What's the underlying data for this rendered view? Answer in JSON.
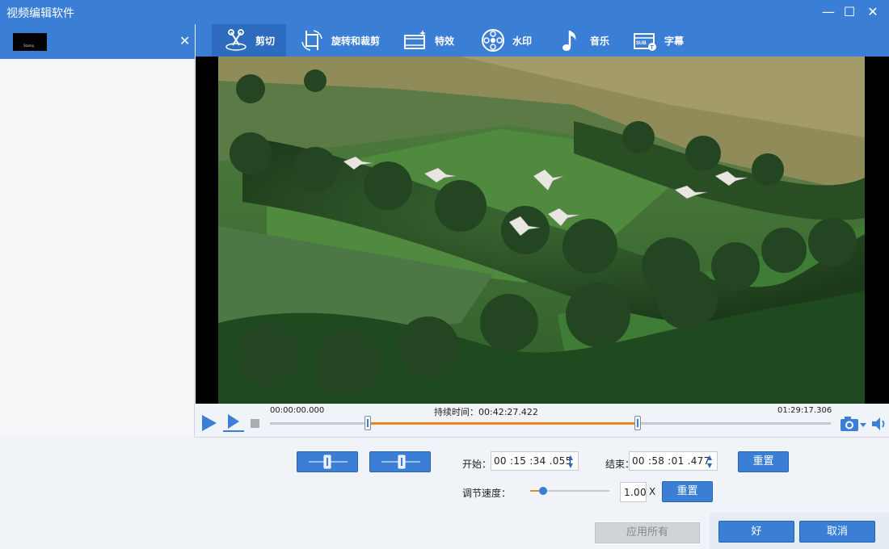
{
  "window": {
    "title": "视频编辑软件",
    "min_glyph": "—",
    "max_glyph": "☐",
    "close_glyph": "✕"
  },
  "clip_list": {
    "close_glyph": "✕",
    "items": [
      {
        "thumb_text": "Stamp"
      }
    ]
  },
  "tabs": [
    {
      "label": "剪切",
      "icon": "scissors-icon",
      "active": true
    },
    {
      "label": "旋转和裁剪",
      "icon": "crop-rotate-icon",
      "active": false
    },
    {
      "label": "特效",
      "icon": "effects-icon",
      "active": false
    },
    {
      "label": "水印",
      "icon": "watermark-icon",
      "active": false
    },
    {
      "label": "音乐",
      "icon": "music-note-icon",
      "active": false
    },
    {
      "label": "字幕",
      "icon": "subtitle-icon",
      "active": false
    }
  ],
  "timeline": {
    "start_time": "00:00:00.000",
    "duration_label": "持续时间：",
    "duration_value": "00:42:27.422",
    "end_time": "01:29:17.306",
    "selection_start_fraction": 0.175,
    "selection_end_fraction": 0.656
  },
  "trim": {
    "start_label": "开始：",
    "start_value": "00 :15 :34 .055",
    "end_label": "结束：",
    "end_value": "00 :58 :01 .477",
    "reset_label": "重置"
  },
  "speed": {
    "label": "调节速度：",
    "value": "1.00",
    "unit": "X",
    "fraction": 0.16,
    "reset_label": "重置"
  },
  "footer": {
    "apply_all_label": "应用所有",
    "ok_label": "好",
    "cancel_label": "取消"
  },
  "colors": {
    "accent": "#3a7fd5",
    "accent_dark": "#2c6bbd",
    "selection": "#f08422"
  }
}
